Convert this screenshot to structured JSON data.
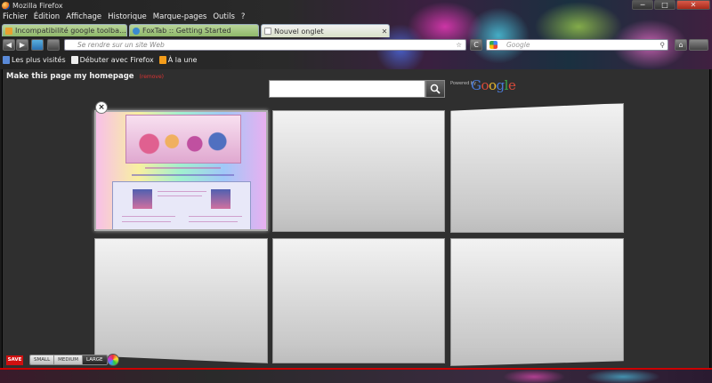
{
  "window": {
    "title": "Mozilla Firefox",
    "controls": {
      "minimize": "─",
      "maximize": "□",
      "close": "✕"
    }
  },
  "menubar": {
    "items": [
      "Fichier",
      "Édition",
      "Affichage",
      "Historique",
      "Marque-pages",
      "Outils",
      "?"
    ]
  },
  "tabs": [
    {
      "label": "Incompatibilité google toolbar et fire...",
      "icon": "page-icon",
      "favicon_color": "#e8a030",
      "active": false
    },
    {
      "label": "FoxTab :: Getting Started",
      "icon": "foxtab-icon",
      "favicon_color": "#3a8ad0",
      "active": false
    },
    {
      "label": "Nouvel onglet",
      "icon": "page-icon",
      "favicon_color": "#ffffff",
      "active": true
    }
  ],
  "navbar": {
    "url_placeholder": "Se rendre sur un site Web",
    "search_placeholder": "Google",
    "back": "◀",
    "forward": "▶",
    "reload": "C",
    "home": "⌂"
  },
  "bookmarks": [
    {
      "label": "Les plus visités",
      "icon": "folder-icon"
    },
    {
      "label": "Débuter avec Firefox",
      "icon": "page-icon"
    },
    {
      "label": "À la une",
      "icon": "rss-icon"
    }
  ],
  "page": {
    "homepage_link": "Make this page my homepage",
    "remove_link": "(remove)",
    "powered_by": "Powered by",
    "google_logo": "Google"
  },
  "controls": {
    "save": "SAVE",
    "sizes": [
      "SMALL",
      "MEDIUM",
      "LARGE"
    ],
    "selected_size": "LARGE"
  },
  "colors": {
    "content_bg": "#2f2f2f",
    "save_red": "#d01010",
    "status_border": "#cc0000"
  }
}
